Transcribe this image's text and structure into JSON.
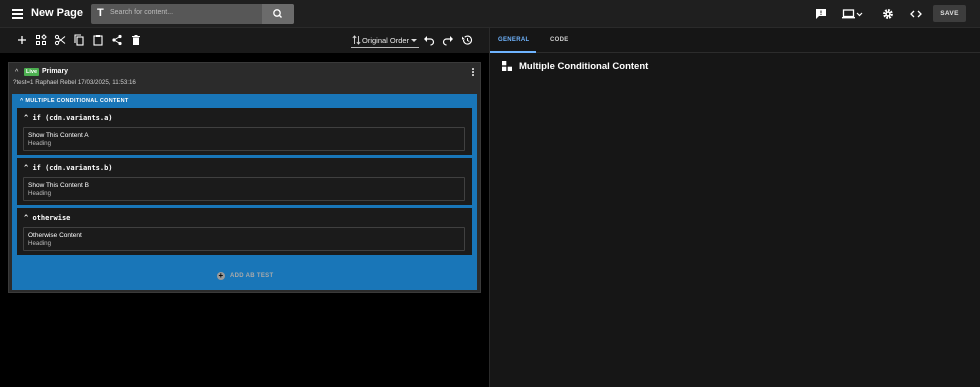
{
  "topbar": {
    "menu_icon": "hamburger-icon",
    "page_title": "New Page",
    "search": {
      "placeholder": "Search for content...",
      "icon": "search-icon"
    },
    "save_label": "SAVE"
  },
  "toolbar": {
    "sort_label": "Original Order",
    "icons": [
      "add-icon",
      "components-icon",
      "cut-icon",
      "copy-icon",
      "paste-icon",
      "share-icon",
      "delete-icon",
      "undo-icon",
      "redo-icon",
      "history-icon"
    ]
  },
  "variant": {
    "status": "Live",
    "title": "Primary",
    "subtitle": "?test=1 Raphael Rebel 17/03/2025, 11:53:16"
  },
  "block": {
    "header": "MULTIPLE CONDITIONAL CONTENT",
    "branches": [
      {
        "condition": "if (cdn.variants.a)",
        "item_title": "Show This Content A",
        "item_type": "Heading"
      },
      {
        "condition": "if (cdn.variants.b)",
        "item_title": "Show This Content B",
        "item_type": "Heading"
      },
      {
        "condition": "otherwise",
        "item_title": "Otherwise Content",
        "item_type": "Heading"
      }
    ]
  },
  "add_ab_test_label": "ADD AB TEST",
  "panel": {
    "tabs": [
      "GENERAL",
      "CODE"
    ],
    "active_tab": "GENERAL",
    "title": "Multiple Conditional Content"
  },
  "colors": {
    "accent_blue": "#1976b8",
    "live_green": "#4caf50",
    "tab_active": "#6fb4ff"
  }
}
